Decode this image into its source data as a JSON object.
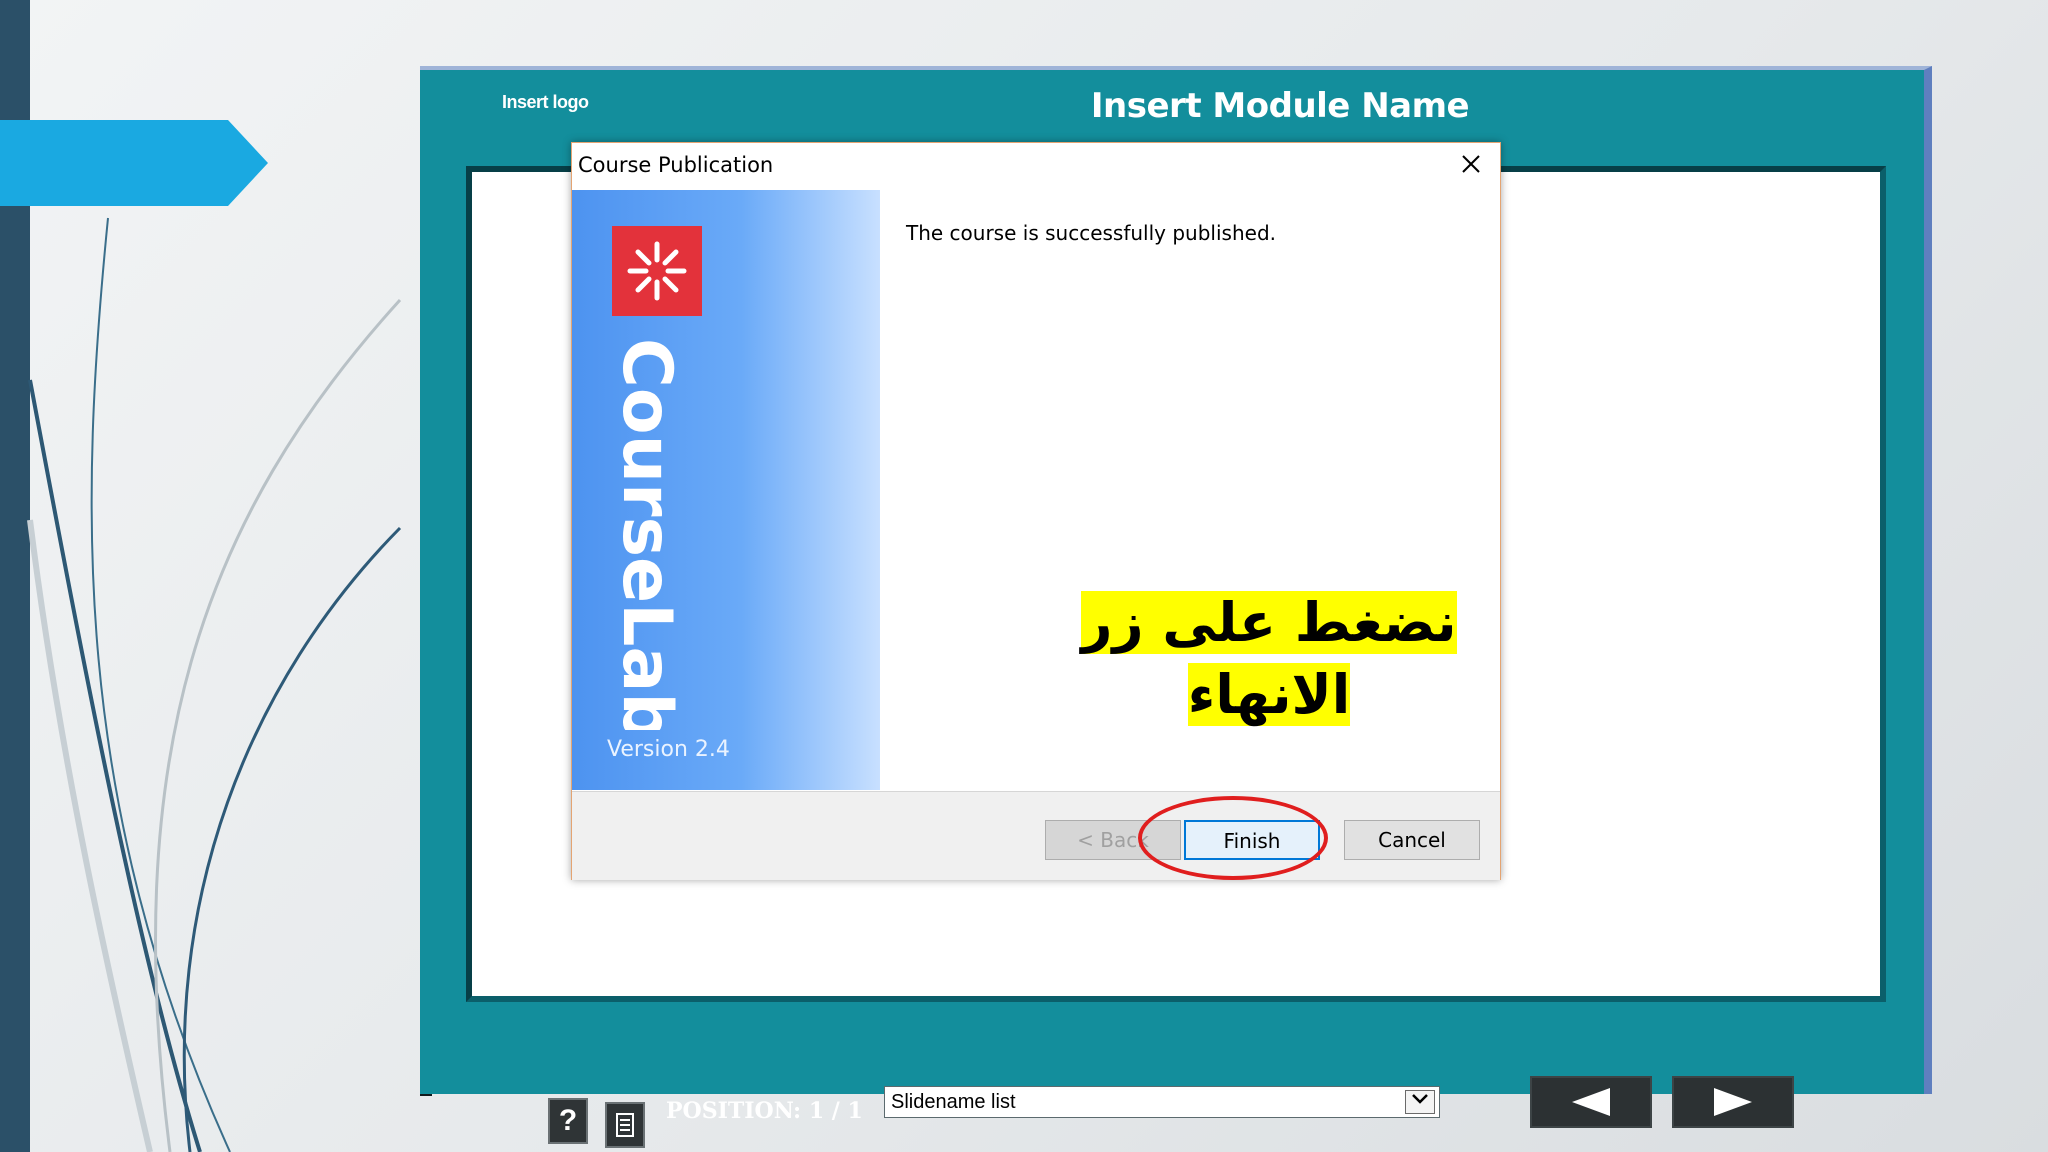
{
  "player": {
    "logo_placeholder": "Insert logo",
    "module_name": "Insert Module Name",
    "position_text": "POSITION: 1 / 1",
    "slide_select_value": "Slidename list",
    "help_label": "?"
  },
  "dialog": {
    "title": "Course Publication",
    "brand_name": "CourseLab",
    "version": "Version 2.4",
    "message": "The course is successfully published.",
    "buttons": {
      "back": "< Back",
      "finish": "Finish",
      "cancel": "Cancel"
    }
  },
  "callout": {
    "line1": "نضغط على زر",
    "line2": "الانهاء"
  },
  "colors": {
    "player_teal": "#138e9c",
    "accent_blue": "#1aa9e1",
    "highlight_yellow": "#ffff00",
    "circle_red": "#e01e1e",
    "brand_red": "#e3323b"
  },
  "icons": {
    "close": "close-icon",
    "help": "help-icon",
    "notes": "notes-icon",
    "prev": "arrow-left-icon",
    "next": "arrow-right-icon",
    "dropdown": "chevron-down-icon",
    "brand": "asterisk-logo-icon"
  }
}
